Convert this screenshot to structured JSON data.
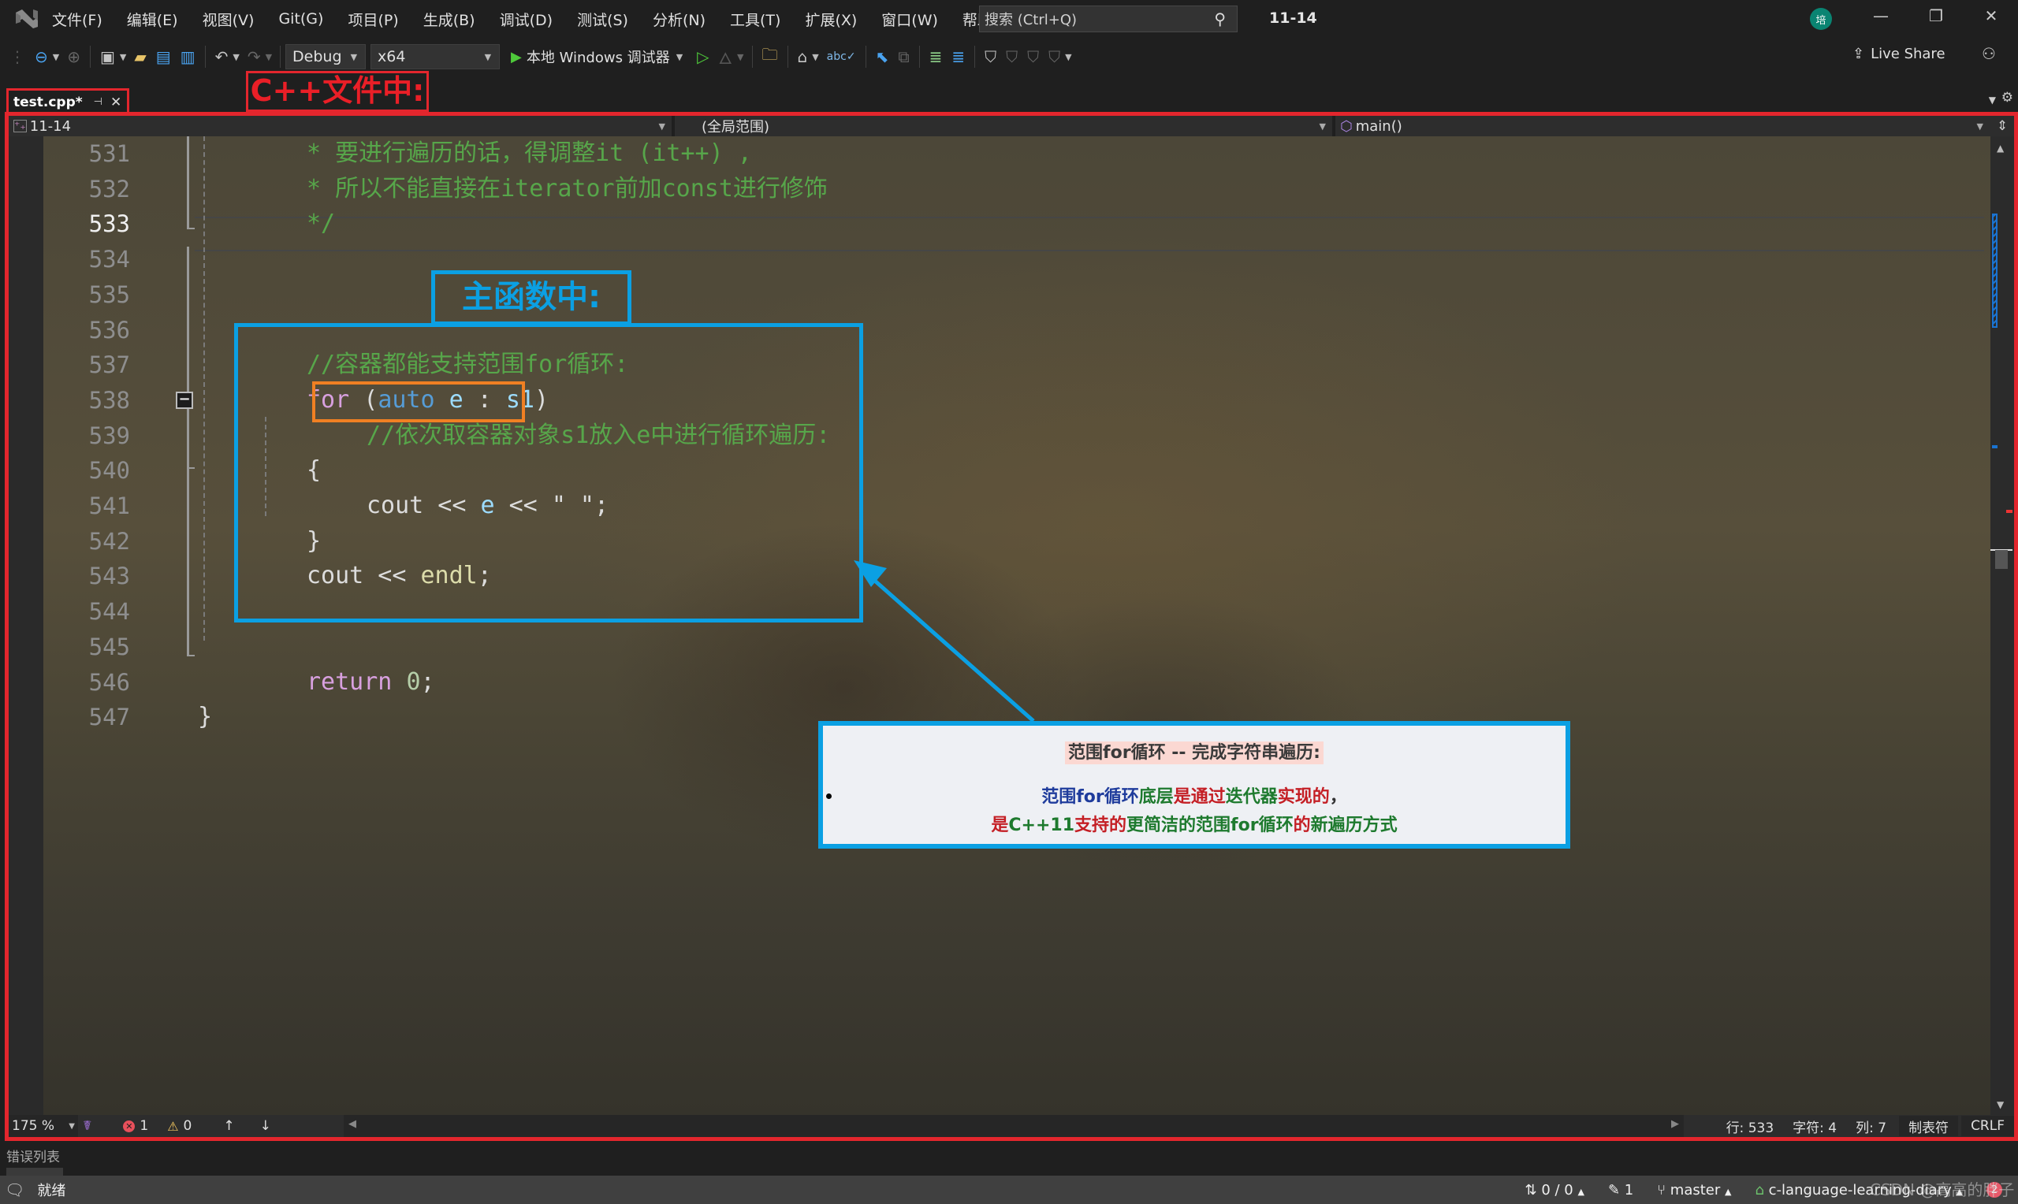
{
  "menu": {
    "items": [
      "文件(F)",
      "编辑(E)",
      "视图(V)",
      "Git(G)",
      "项目(P)",
      "生成(B)",
      "调试(D)",
      "测试(S)",
      "分析(N)",
      "工具(T)",
      "扩展(X)",
      "窗口(W)",
      "帮助(H)"
    ],
    "search_placeholder": "搜索 (Ctrl+Q)",
    "solution_name": "11-14",
    "avatar_initial": "培"
  },
  "toolbar": {
    "configuration": "Debug",
    "platform": "x64",
    "run_label": "本地 Windows 调试器",
    "live_share": "Live Share"
  },
  "tabs": {
    "file_tab": "test.cpp*",
    "pin_glyph": "⊣",
    "close_glyph": "✕"
  },
  "annotations": {
    "file_label": "C++文件中:",
    "main_label": "主函数中:",
    "callout_title": "范围for循环 -- 完成字符串遍历:",
    "callout_line1": [
      {
        "text": "范围for循环",
        "color": "blue"
      },
      {
        "text": "底层",
        "color": "green"
      },
      {
        "text": "是通过",
        "color": "red"
      },
      {
        "text": "迭代器",
        "color": "green"
      },
      {
        "text": "实现的",
        "color": "red"
      },
      {
        "text": "，",
        "color": "dark"
      }
    ],
    "callout_line2": [
      {
        "text": "是",
        "color": "red"
      },
      {
        "text": "C++11",
        "color": "green"
      },
      {
        "text": "支持的",
        "color": "red"
      },
      {
        "text": "更简洁的范围for循环",
        "color": "green"
      },
      {
        "text": "的",
        "color": "red"
      },
      {
        "text": "新遍历方式",
        "color": "green"
      }
    ]
  },
  "navbar": {
    "project": "11-14",
    "scope": "(全局范围)",
    "member": "main()"
  },
  "editor": {
    "current_line": 533,
    "lines": [
      {
        "num": "531",
        "tokens": [
          {
            "t": "* 要进行遍历的话，得调整it (it++) ,",
            "c": "comment"
          }
        ],
        "indent": 1
      },
      {
        "num": "532",
        "tokens": [
          {
            "t": "* 所以不能直接在iterator前加const进行修饰",
            "c": "comment"
          }
        ],
        "indent": 1
      },
      {
        "num": "533",
        "tokens": [
          {
            "t": "*/",
            "c": "comment"
          }
        ],
        "indent": 1
      },
      {
        "num": "534",
        "tokens": [],
        "indent": 1
      },
      {
        "num": "535",
        "tokens": [],
        "indent": 1
      },
      {
        "num": "536",
        "tokens": [],
        "indent": 1
      },
      {
        "num": "537",
        "tokens": [
          {
            "t": "//容器都能支持范围for循环:",
            "c": "comment"
          }
        ],
        "indent": 1
      },
      {
        "num": "538",
        "tokens": [
          {
            "t": "for",
            "c": "keyword"
          },
          {
            "t": " (",
            "c": "plain"
          },
          {
            "t": "auto",
            "c": "type"
          },
          {
            "t": " ",
            "c": "plain"
          },
          {
            "t": "e",
            "c": "var"
          },
          {
            "t": " : ",
            "c": "plain"
          },
          {
            "t": "s1",
            "c": "var"
          },
          {
            "t": ")",
            "c": "plain"
          }
        ],
        "indent": 1
      },
      {
        "num": "539",
        "tokens": [
          {
            "t": "//依次取容器对象s1放入e中进行循环遍历:",
            "c": "comment"
          }
        ],
        "indent": 2
      },
      {
        "num": "540",
        "tokens": [
          {
            "t": "{",
            "c": "plain"
          }
        ],
        "indent": 1
      },
      {
        "num": "541",
        "tokens": [
          {
            "t": "cout",
            "c": "plain"
          },
          {
            "t": " << ",
            "c": "plain"
          },
          {
            "t": "e",
            "c": "var"
          },
          {
            "t": " << ",
            "c": "plain"
          },
          {
            "t": "\" \"",
            "c": "plain"
          },
          {
            "t": ";",
            "c": "plain"
          }
        ],
        "indent": 2
      },
      {
        "num": "542",
        "tokens": [
          {
            "t": "}",
            "c": "plain"
          }
        ],
        "indent": 1
      },
      {
        "num": "543",
        "tokens": [
          {
            "t": "cout",
            "c": "plain"
          },
          {
            "t": " << ",
            "c": "plain"
          },
          {
            "t": "endl",
            "c": "func"
          },
          {
            "t": ";",
            "c": "plain"
          }
        ],
        "indent": 1
      },
      {
        "num": "544",
        "tokens": [],
        "indent": 1
      },
      {
        "num": "545",
        "tokens": [],
        "indent": 1
      },
      {
        "num": "546",
        "tokens": [
          {
            "t": "return",
            "c": "keyword"
          },
          {
            "t": " ",
            "c": "plain"
          },
          {
            "t": "0",
            "c": "num"
          },
          {
            "t": ";",
            "c": "plain"
          }
        ],
        "indent": 1
      },
      {
        "num": "547",
        "tokens": [
          {
            "t": "}",
            "c": "plain"
          }
        ],
        "indent": 0
      }
    ]
  },
  "editor_status": {
    "zoom": "175 %",
    "errors": "1",
    "warnings": "0",
    "line": "行: 533",
    "char": "字符: 4",
    "col": "列: 7",
    "indent_mode": "制表符",
    "line_ending": "CRLF"
  },
  "panels": {
    "error_list_tab": "错误列表"
  },
  "statusbar": {
    "ready": "就绪",
    "sync": "0 / 0",
    "pending_changes": "1",
    "branch": "master",
    "repo": "c-language-learning-diary",
    "notifications": "2",
    "watermark": "CSDN @高高的胖子"
  },
  "colors": {
    "annotation_red": "#e3262d",
    "annotation_blue": "#0ba0e3",
    "annotation_orange": "#f08023",
    "comment": "#57a64a",
    "keyword": "#d8a0df",
    "type": "#569cd6"
  }
}
